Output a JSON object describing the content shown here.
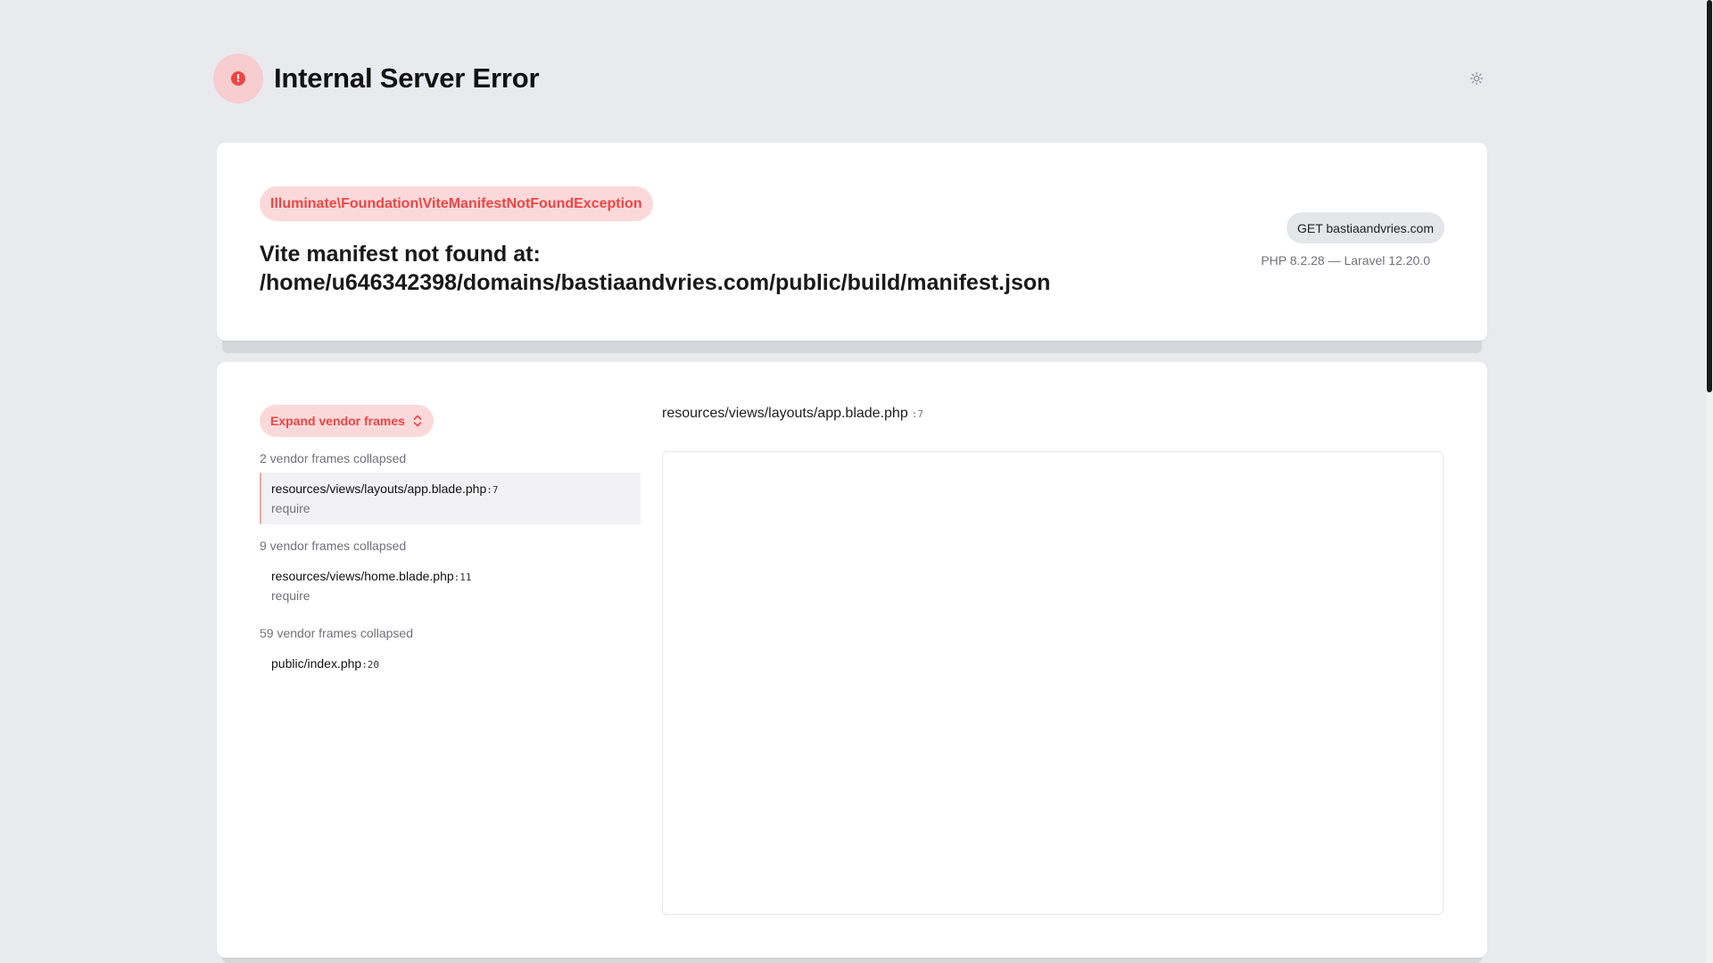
{
  "header": {
    "title": "Internal Server Error",
    "badge_symbol": "!"
  },
  "exception": {
    "class": "Illuminate\\Foundation\\ViteManifestNotFoundException",
    "message_line1": "Vite manifest not found at:",
    "message_line2": "/home/u646342398/domains/bastiaandvries.com/public/build/manifest.json",
    "request": "GET bastiaandvries.com",
    "versions": "PHP 8.2.28 — Laravel 12.20.0"
  },
  "trace": {
    "expand_label": "Expand vendor frames",
    "groups": [
      {
        "collapsed_label": "2 vendor frames collapsed",
        "frame": {
          "file": "resources/views/layouts/app.blade.php",
          "line": ":7",
          "function": "require"
        }
      },
      {
        "collapsed_label": "9 vendor frames collapsed",
        "frame": {
          "file": "resources/views/home.blade.php",
          "line": ":11",
          "function": "require"
        }
      },
      {
        "collapsed_label": "59 vendor frames collapsed",
        "frame": {
          "file": "public/index.php",
          "line": ":20",
          "function": ""
        }
      }
    ],
    "code_file": "resources/views/layouts/app.blade.php",
    "code_line": ":7"
  },
  "colors": {
    "accent": "#ef4444",
    "accent_bg": "#fbd9da",
    "page_bg": "#e9eaee"
  },
  "icons": {
    "theme_toggle": "sun-icon",
    "expand": "chevron-up-down-icon",
    "error": "exclamation-circle-icon"
  }
}
